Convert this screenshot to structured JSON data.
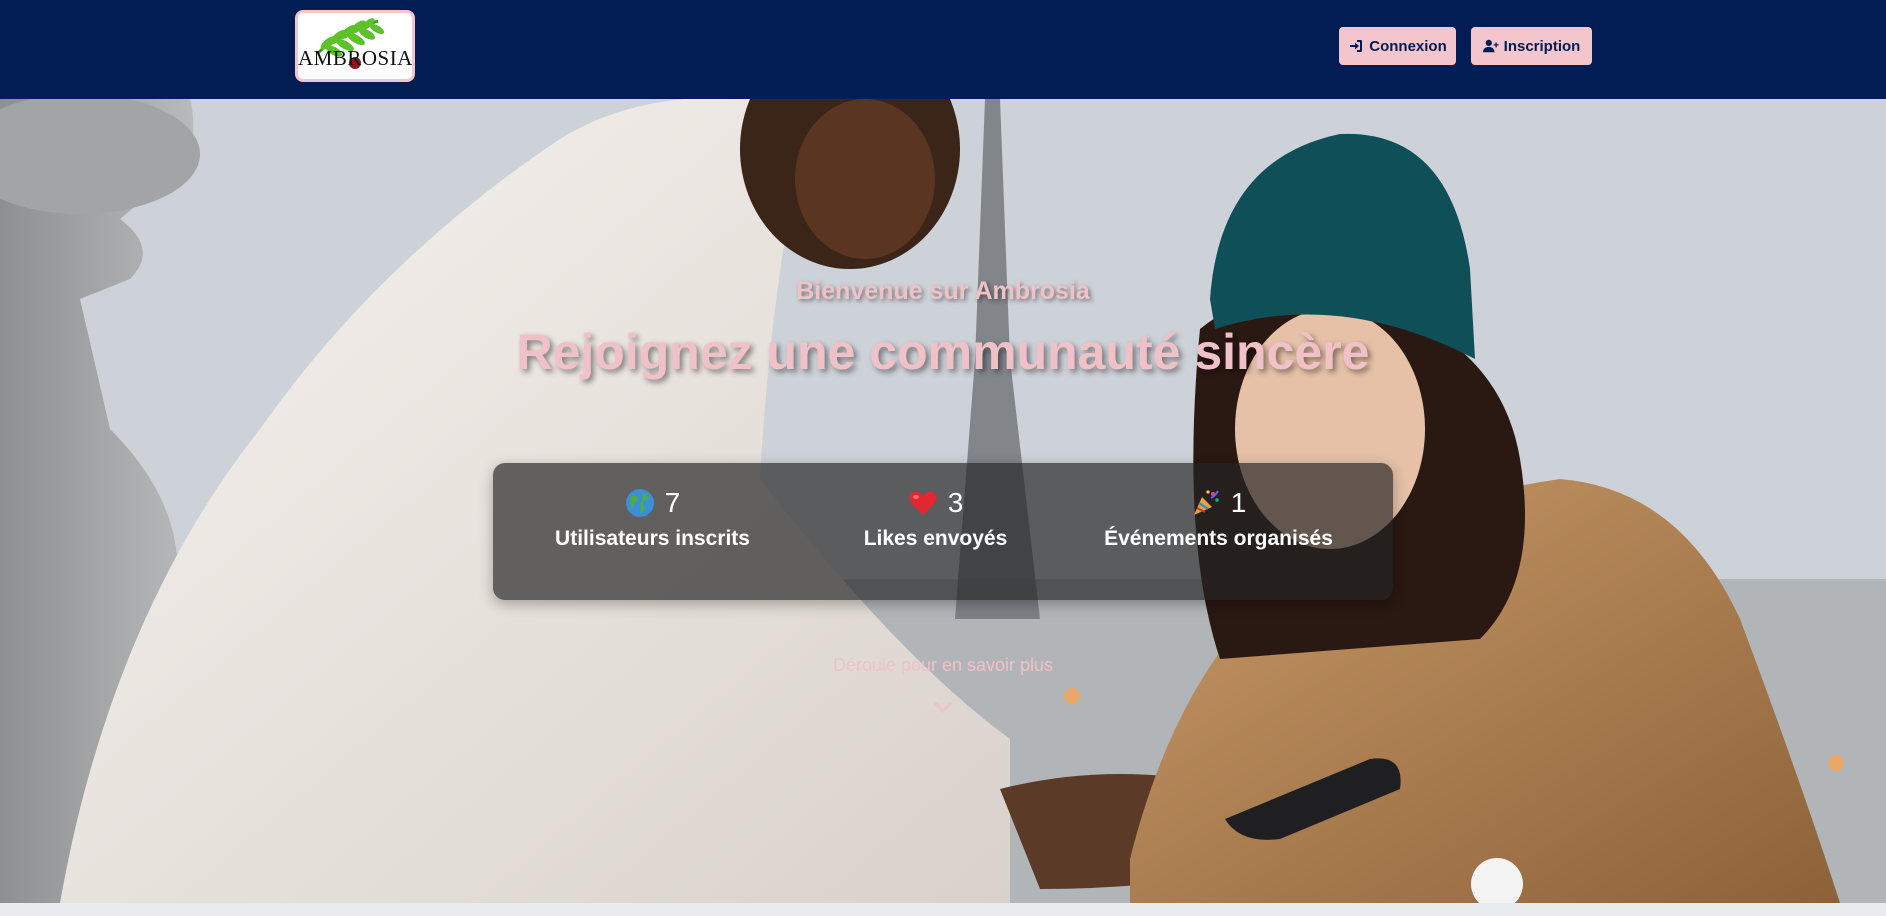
{
  "navbar": {
    "logo_text": "AMBROSIA",
    "login_label": "Connexion",
    "signup_label": "Inscription"
  },
  "hero": {
    "subtitle": "Bienvenue sur Ambrosia",
    "title": "Rejoignez une communauté sincère",
    "scroll_hint": "Déroule pour en savoir plus"
  },
  "stats": [
    {
      "icon": "globe-icon",
      "value": "7",
      "label": "Utilisateurs inscrits"
    },
    {
      "icon": "heart-icon",
      "value": "3",
      "label": "Likes envoyés"
    },
    {
      "icon": "party-popper-icon",
      "value": "1",
      "label": "Événements organisés"
    }
  ],
  "colors": {
    "navbar_bg": "#021d54",
    "accent_pink": "#f2c6cc",
    "stats_panel": "#232323"
  }
}
